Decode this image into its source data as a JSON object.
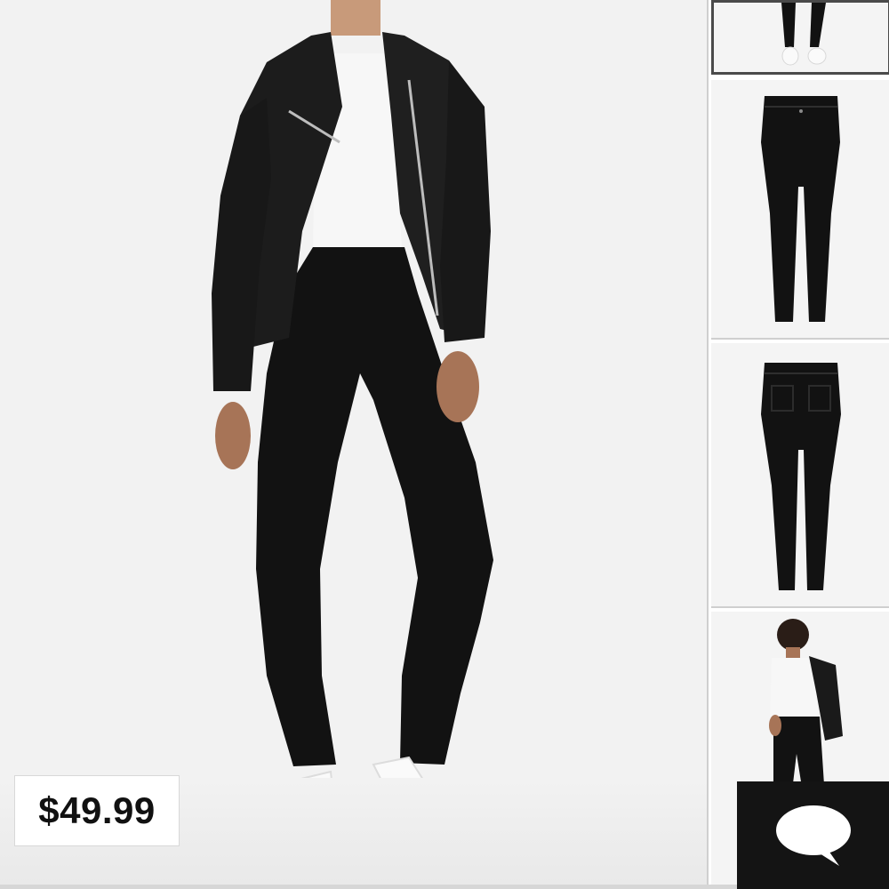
{
  "product": {
    "price": "$49.99",
    "main_image_icon": "model-wearing-jacket-and-black-skinny-jeans"
  },
  "thumbnails": [
    {
      "icon": "model-legs-white-sneakers",
      "selected": true
    },
    {
      "icon": "black-jeans-front"
    },
    {
      "icon": "black-jeans-back"
    },
    {
      "icon": "model-back-view-holding-jacket"
    }
  ],
  "chat": {
    "icon": "speech-bubble-icon"
  },
  "colors": {
    "jeans": "#121212",
    "jacket": "#1c1c1c",
    "chat_background": "#141414",
    "thumbnail_selected_border": "#4a4a4a"
  }
}
